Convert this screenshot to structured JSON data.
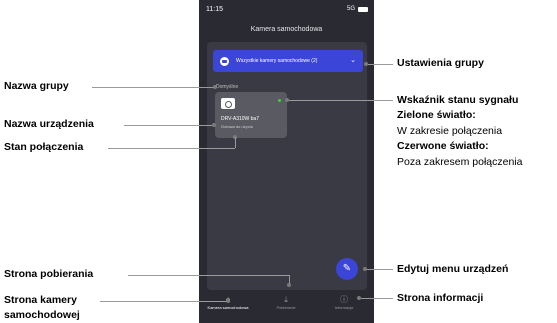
{
  "phone": {
    "status": {
      "time": "11:15",
      "network": "5G"
    },
    "app_title": "Kamera samochodowa",
    "group_button": {
      "label": "Wszystkie kamery samochodowe (2)",
      "chevron": "chevron-down-icon"
    },
    "group_name": "Domyślne",
    "device": {
      "name": "DRV-A310W ba7",
      "status": "Gotowa do użycia",
      "signal_color": "#3ad13a"
    },
    "fab_icon": "pencil-icon",
    "tabs": [
      {
        "label": "Kamera samochodowa",
        "icon": "home-icon",
        "active": true
      },
      {
        "label": "Pobieranie",
        "icon": "download-icon",
        "active": false
      },
      {
        "label": "Informacje",
        "icon": "info-icon",
        "active": false
      }
    ]
  },
  "annotations": {
    "group_name": "Nazwa grupy",
    "device_name": "Nazwa urządzenia",
    "connection_status": "Stan połączenia",
    "download_page_label": "Strona pobierania",
    "camera_page_label_1": "Strona kamery",
    "camera_page_label_2": "samochodowej",
    "group_settings": "Ustawienia grupy",
    "signal_title": "Wskaźnik stanu sygnału",
    "green_title": "Zielone światło:",
    "green_text": "W zakresie połączenia",
    "red_title": "Czerwone światło:",
    "red_text": "Poza zakresem połączenia",
    "edit_menu": "Edytuj menu urządzeń",
    "info_page": "Strona informacji"
  },
  "colors": {
    "accent": "#3b45d8",
    "phone_bg": "#2a2a32",
    "card": "#5a5a62"
  }
}
